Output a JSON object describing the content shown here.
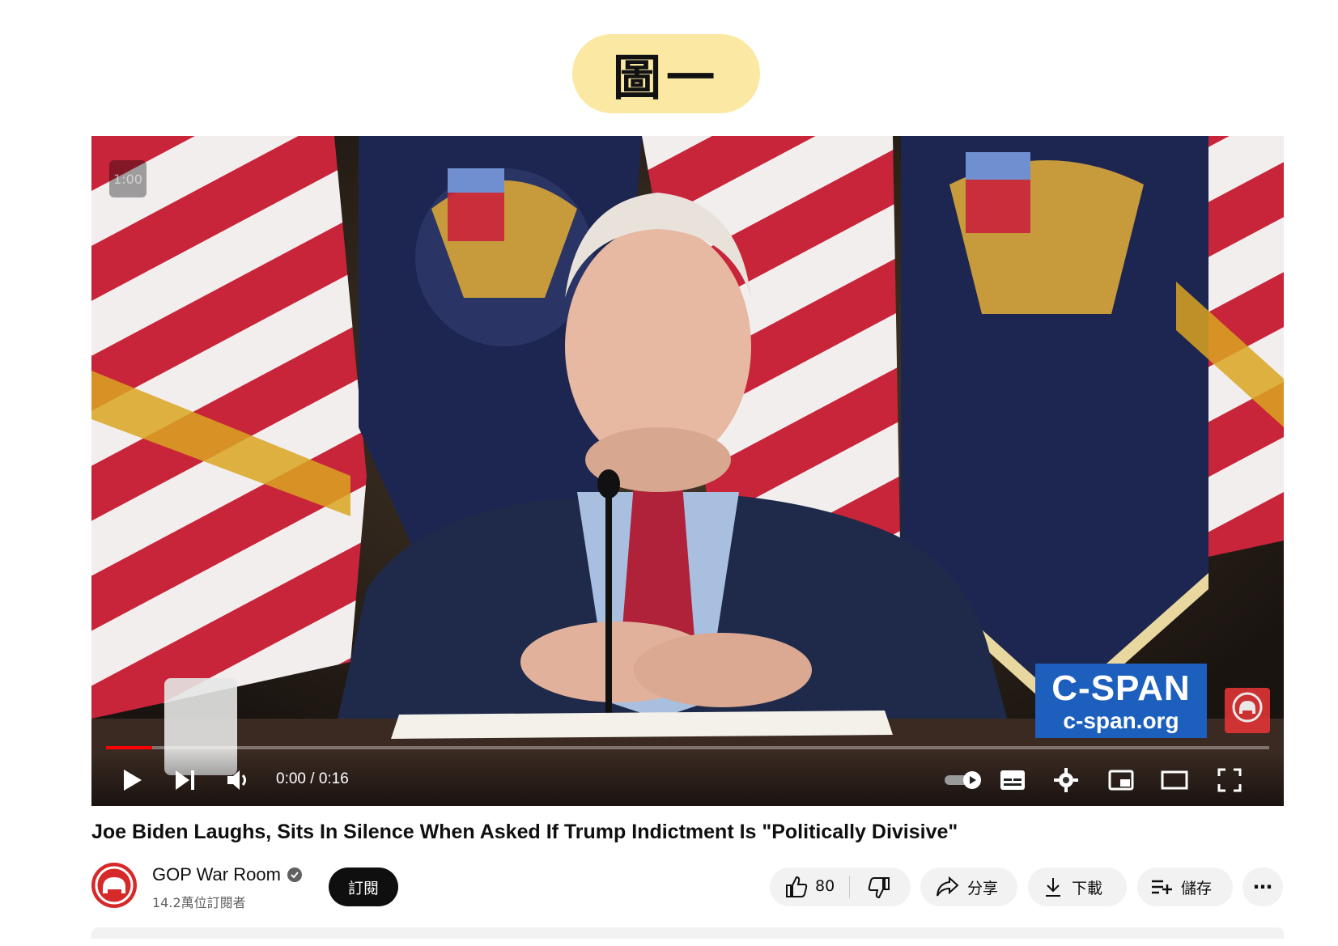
{
  "figure_label": "圖一",
  "player": {
    "overlay_time": "1:00",
    "current_time": "0:00",
    "duration": "0:16",
    "time_display": "0:00 / 0:16",
    "progress": 0.04,
    "cspan_logo": {
      "line1": "C-SPAN",
      "line2": "c-span.org"
    },
    "subscribe_badge": "Subscribe"
  },
  "video": {
    "title": "Joe Biden Laughs, Sits In Silence When Asked If Trump Indictment Is \"Politically Divisive\""
  },
  "channel": {
    "name": "GOP War Room",
    "subscribers": "14.2萬位訂閱者",
    "subscribe_label": "訂閱"
  },
  "actions": {
    "like_count": "80",
    "share_label": "分享",
    "download_label": "下載",
    "save_label": "儲存",
    "more_label": "⋯"
  },
  "colors": {
    "label_bg": "#fbe8a3",
    "progress_red": "#ff0000",
    "cspan_blue": "#1d5fbd",
    "button_black": "#0f0f0f",
    "pill_gray": "#f2f2f2"
  }
}
